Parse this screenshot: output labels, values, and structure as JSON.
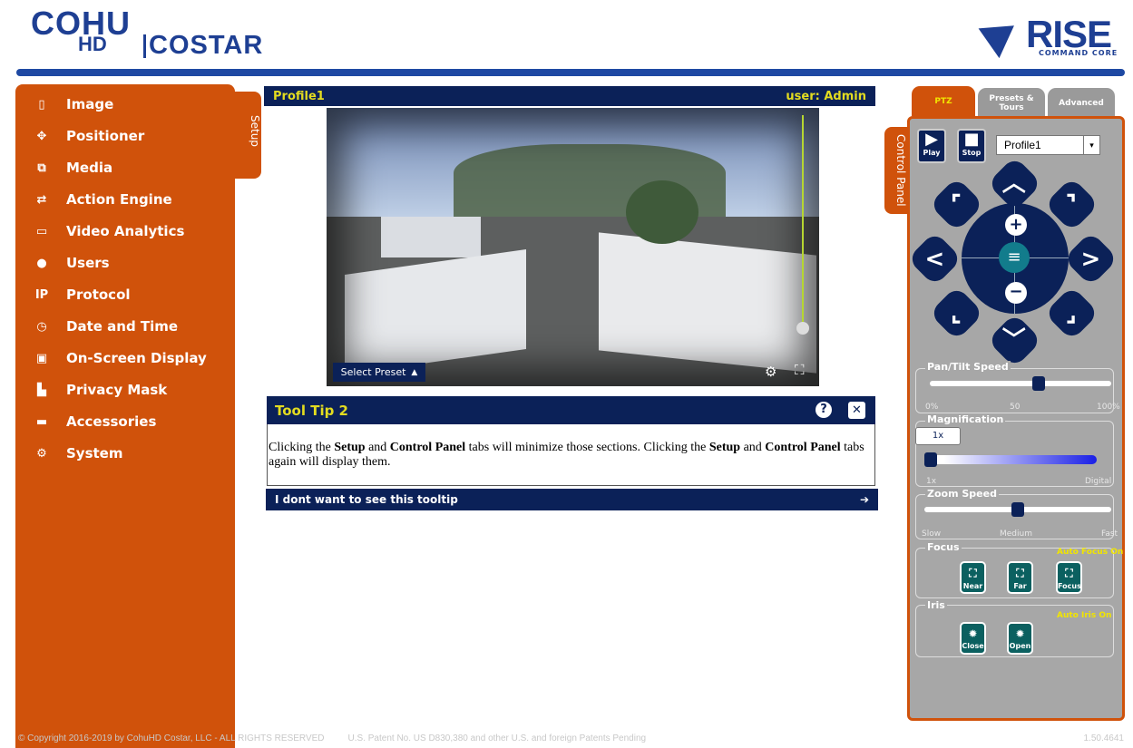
{
  "header": {
    "logo_line1": "COHU",
    "logo_line2": "HD",
    "logo_line3": "COSTAR",
    "rise_word": "RISE",
    "rise_sub": "COMMAND CORE"
  },
  "sidebar": {
    "items": [
      {
        "label": "Image",
        "icon": "image-icon"
      },
      {
        "label": "Positioner",
        "icon": "positioner-icon"
      },
      {
        "label": "Media",
        "icon": "media-icon"
      },
      {
        "label": "Action Engine",
        "icon": "shuffle-icon"
      },
      {
        "label": "Video Analytics",
        "icon": "monitor-icon"
      },
      {
        "label": "Users",
        "icon": "user-icon"
      },
      {
        "label": "Protocol",
        "icon": "ip-icon"
      },
      {
        "label": "Date and Time",
        "icon": "clock-icon"
      },
      {
        "label": "On-Screen Display",
        "icon": "display-icon"
      },
      {
        "label": "Privacy Mask",
        "icon": "mask-icon"
      },
      {
        "label": "Accessories",
        "icon": "accessories-icon"
      },
      {
        "label": "System",
        "icon": "gear-icon"
      }
    ],
    "setup_tab": "Setup"
  },
  "video": {
    "profile": "Profile1",
    "user": "user: Admin",
    "preset_label": "Select Preset"
  },
  "tooltip": {
    "title": "Tool Tip 2",
    "q": "?",
    "x": "✕",
    "t1": "Clicking the ",
    "b1": "Setup",
    "t2": " and ",
    "b2": "Control Panel",
    "t3": " tabs will minimize those sections. Clicking the ",
    "b3": "Setup",
    "t4": " and ",
    "b4": "Control Panel",
    "t5": " tabs again will display them.",
    "footer": "I dont want to see this tooltip",
    "footer_arrow": "➔"
  },
  "control": {
    "tab_label": "Control Panel",
    "tabs": [
      {
        "label": "PTZ"
      },
      {
        "label": "Presets & Tours"
      },
      {
        "label": "Advanced"
      }
    ],
    "play": "Play",
    "stop": "Stop",
    "profile_select": "Profile1",
    "pan_tilt": {
      "label": "Pan/Tilt Speed",
      "min": "0%",
      "mid": "50",
      "max": "100%",
      "value": 60
    },
    "magnification": {
      "label": "Magnification",
      "value_label": "1x",
      "min": "1x",
      "max": "Digital",
      "value": 0
    },
    "zoom_speed": {
      "label": "Zoom Speed",
      "min": "Slow",
      "mid": "Medium",
      "max": "Fast",
      "value": 50
    },
    "focus": {
      "label": "Focus",
      "auto": "Auto Focus On",
      "near": "Near",
      "far": "Far",
      "focus": "Focus"
    },
    "iris": {
      "label": "Iris",
      "auto": "Auto Iris On",
      "close": "Close",
      "open": "Open"
    }
  },
  "footer": {
    "copyright": "© Copyright 2016-2019 by CohuHD Costar, LLC - ALL RIGHTS RESERVED",
    "patent": "U.S. Patent No. US D830,380 and other U.S. and foreign Patents Pending",
    "version": "1.50.4641"
  }
}
